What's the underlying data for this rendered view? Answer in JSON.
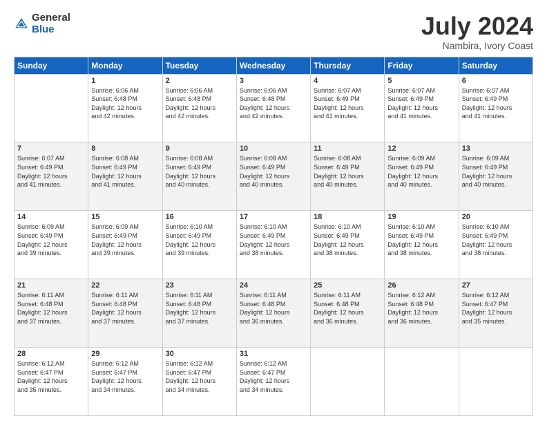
{
  "logo": {
    "general": "General",
    "blue": "Blue"
  },
  "title": "July 2024",
  "subtitle": "Nambira, Ivory Coast",
  "weekdays": [
    "Sunday",
    "Monday",
    "Tuesday",
    "Wednesday",
    "Thursday",
    "Friday",
    "Saturday"
  ],
  "weeks": [
    [
      {
        "day": "",
        "info": ""
      },
      {
        "day": "1",
        "info": "Sunrise: 6:06 AM\nSunset: 6:48 PM\nDaylight: 12 hours\nand 42 minutes."
      },
      {
        "day": "2",
        "info": "Sunrise: 6:06 AM\nSunset: 6:48 PM\nDaylight: 12 hours\nand 42 minutes."
      },
      {
        "day": "3",
        "info": "Sunrise: 6:06 AM\nSunset: 6:48 PM\nDaylight: 12 hours\nand 42 minutes."
      },
      {
        "day": "4",
        "info": "Sunrise: 6:07 AM\nSunset: 6:49 PM\nDaylight: 12 hours\nand 41 minutes."
      },
      {
        "day": "5",
        "info": "Sunrise: 6:07 AM\nSunset: 6:49 PM\nDaylight: 12 hours\nand 41 minutes."
      },
      {
        "day": "6",
        "info": "Sunrise: 6:07 AM\nSunset: 6:49 PM\nDaylight: 12 hours\nand 41 minutes."
      }
    ],
    [
      {
        "day": "7",
        "info": "Sunrise: 6:07 AM\nSunset: 6:49 PM\nDaylight: 12 hours\nand 41 minutes."
      },
      {
        "day": "8",
        "info": "Sunrise: 6:08 AM\nSunset: 6:49 PM\nDaylight: 12 hours\nand 41 minutes."
      },
      {
        "day": "9",
        "info": "Sunrise: 6:08 AM\nSunset: 6:49 PM\nDaylight: 12 hours\nand 40 minutes."
      },
      {
        "day": "10",
        "info": "Sunrise: 6:08 AM\nSunset: 6:49 PM\nDaylight: 12 hours\nand 40 minutes."
      },
      {
        "day": "11",
        "info": "Sunrise: 6:08 AM\nSunset: 6:49 PM\nDaylight: 12 hours\nand 40 minutes."
      },
      {
        "day": "12",
        "info": "Sunrise: 6:09 AM\nSunset: 6:49 PM\nDaylight: 12 hours\nand 40 minutes."
      },
      {
        "day": "13",
        "info": "Sunrise: 6:09 AM\nSunset: 6:49 PM\nDaylight: 12 hours\nand 40 minutes."
      }
    ],
    [
      {
        "day": "14",
        "info": "Sunrise: 6:09 AM\nSunset: 6:49 PM\nDaylight: 12 hours\nand 39 minutes."
      },
      {
        "day": "15",
        "info": "Sunrise: 6:09 AM\nSunset: 6:49 PM\nDaylight: 12 hours\nand 39 minutes."
      },
      {
        "day": "16",
        "info": "Sunrise: 6:10 AM\nSunset: 6:49 PM\nDaylight: 12 hours\nand 39 minutes."
      },
      {
        "day": "17",
        "info": "Sunrise: 6:10 AM\nSunset: 6:49 PM\nDaylight: 12 hours\nand 38 minutes."
      },
      {
        "day": "18",
        "info": "Sunrise: 6:10 AM\nSunset: 6:49 PM\nDaylight: 12 hours\nand 38 minutes."
      },
      {
        "day": "19",
        "info": "Sunrise: 6:10 AM\nSunset: 6:49 PM\nDaylight: 12 hours\nand 38 minutes."
      },
      {
        "day": "20",
        "info": "Sunrise: 6:10 AM\nSunset: 6:49 PM\nDaylight: 12 hours\nand 38 minutes."
      }
    ],
    [
      {
        "day": "21",
        "info": "Sunrise: 6:11 AM\nSunset: 6:48 PM\nDaylight: 12 hours\nand 37 minutes."
      },
      {
        "day": "22",
        "info": "Sunrise: 6:11 AM\nSunset: 6:48 PM\nDaylight: 12 hours\nand 37 minutes."
      },
      {
        "day": "23",
        "info": "Sunrise: 6:11 AM\nSunset: 6:48 PM\nDaylight: 12 hours\nand 37 minutes."
      },
      {
        "day": "24",
        "info": "Sunrise: 6:11 AM\nSunset: 6:48 PM\nDaylight: 12 hours\nand 36 minutes."
      },
      {
        "day": "25",
        "info": "Sunrise: 6:11 AM\nSunset: 6:48 PM\nDaylight: 12 hours\nand 36 minutes."
      },
      {
        "day": "26",
        "info": "Sunrise: 6:12 AM\nSunset: 6:48 PM\nDaylight: 12 hours\nand 36 minutes."
      },
      {
        "day": "27",
        "info": "Sunrise: 6:12 AM\nSunset: 6:47 PM\nDaylight: 12 hours\nand 35 minutes."
      }
    ],
    [
      {
        "day": "28",
        "info": "Sunrise: 6:12 AM\nSunset: 6:47 PM\nDaylight: 12 hours\nand 35 minutes."
      },
      {
        "day": "29",
        "info": "Sunrise: 6:12 AM\nSunset: 6:47 PM\nDaylight: 12 hours\nand 34 minutes."
      },
      {
        "day": "30",
        "info": "Sunrise: 6:12 AM\nSunset: 6:47 PM\nDaylight: 12 hours\nand 34 minutes."
      },
      {
        "day": "31",
        "info": "Sunrise: 6:12 AM\nSunset: 6:47 PM\nDaylight: 12 hours\nand 34 minutes."
      },
      {
        "day": "",
        "info": ""
      },
      {
        "day": "",
        "info": ""
      },
      {
        "day": "",
        "info": ""
      }
    ]
  ]
}
